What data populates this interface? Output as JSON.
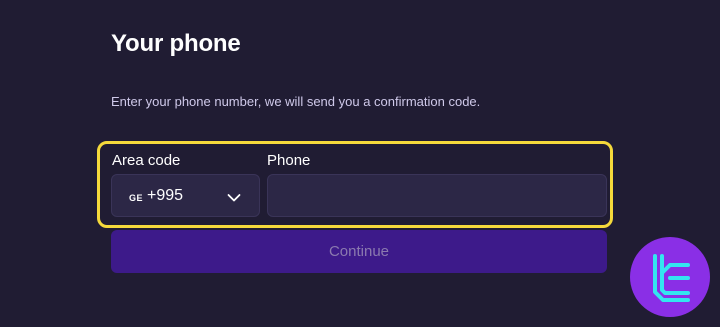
{
  "page": {
    "title": "Your phone",
    "subtitle": "Enter your phone number, we will send you a confirmation code."
  },
  "form": {
    "area_code_label": "Area code",
    "area_code": {
      "flag": "GE",
      "dial_code": "+995",
      "icon": "chevron-down-icon"
    },
    "phone_label": "Phone",
    "phone_value": "",
    "continue_label": "Continue"
  },
  "colors": {
    "background": "#201c33",
    "input_background": "#2c2746",
    "highlight": "#f5d93b",
    "button_background": "#3d1a8a",
    "button_text": "#8b7aaf",
    "logo_background": "#8a2fe6",
    "logo_stroke": "#33e6f0"
  }
}
